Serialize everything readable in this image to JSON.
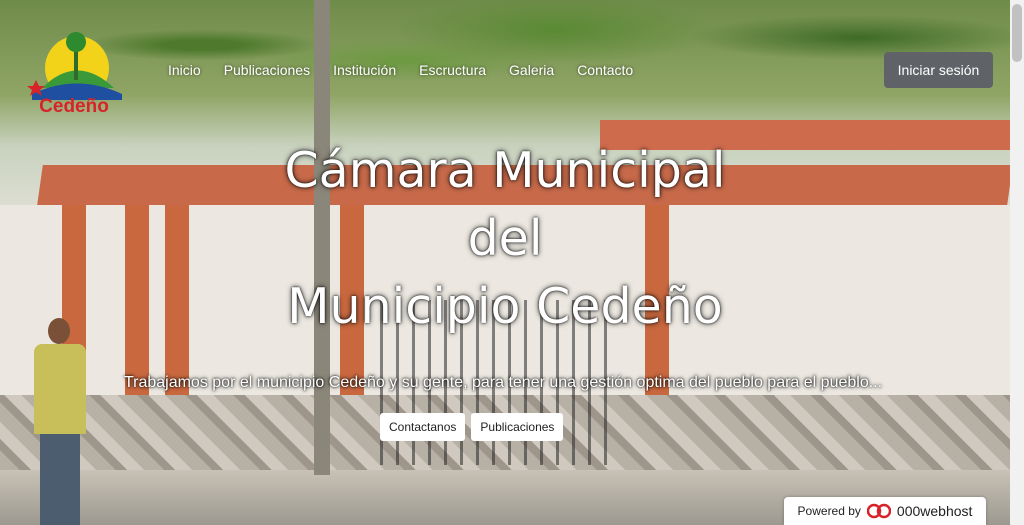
{
  "brand": {
    "logo_text": "Cedeño"
  },
  "nav": {
    "items": [
      "Inicio",
      "Publicaciones",
      "Institución",
      "Escructura",
      "Galeria",
      "Contacto"
    ]
  },
  "header": {
    "login_label": "Iniciar sesión"
  },
  "hero": {
    "title_line1": "Cámara Municipal",
    "title_line2": "del",
    "title_line3": "Municipio Cedeño",
    "subtitle": "Trabajamos por el municipio Cedeño y su gente, para tener una gestión optima del pueblo para el pueblo...",
    "buttons": {
      "contact": "Contactanos",
      "publications": "Publicaciones"
    }
  },
  "footer_badge": {
    "powered": "Powered by",
    "host": "000webhost"
  },
  "colors": {
    "login_bg": "#5f6368",
    "logo_red": "#d8232a",
    "logo_yellow": "#f3d21a",
    "logo_blue": "#1f4fa0"
  }
}
